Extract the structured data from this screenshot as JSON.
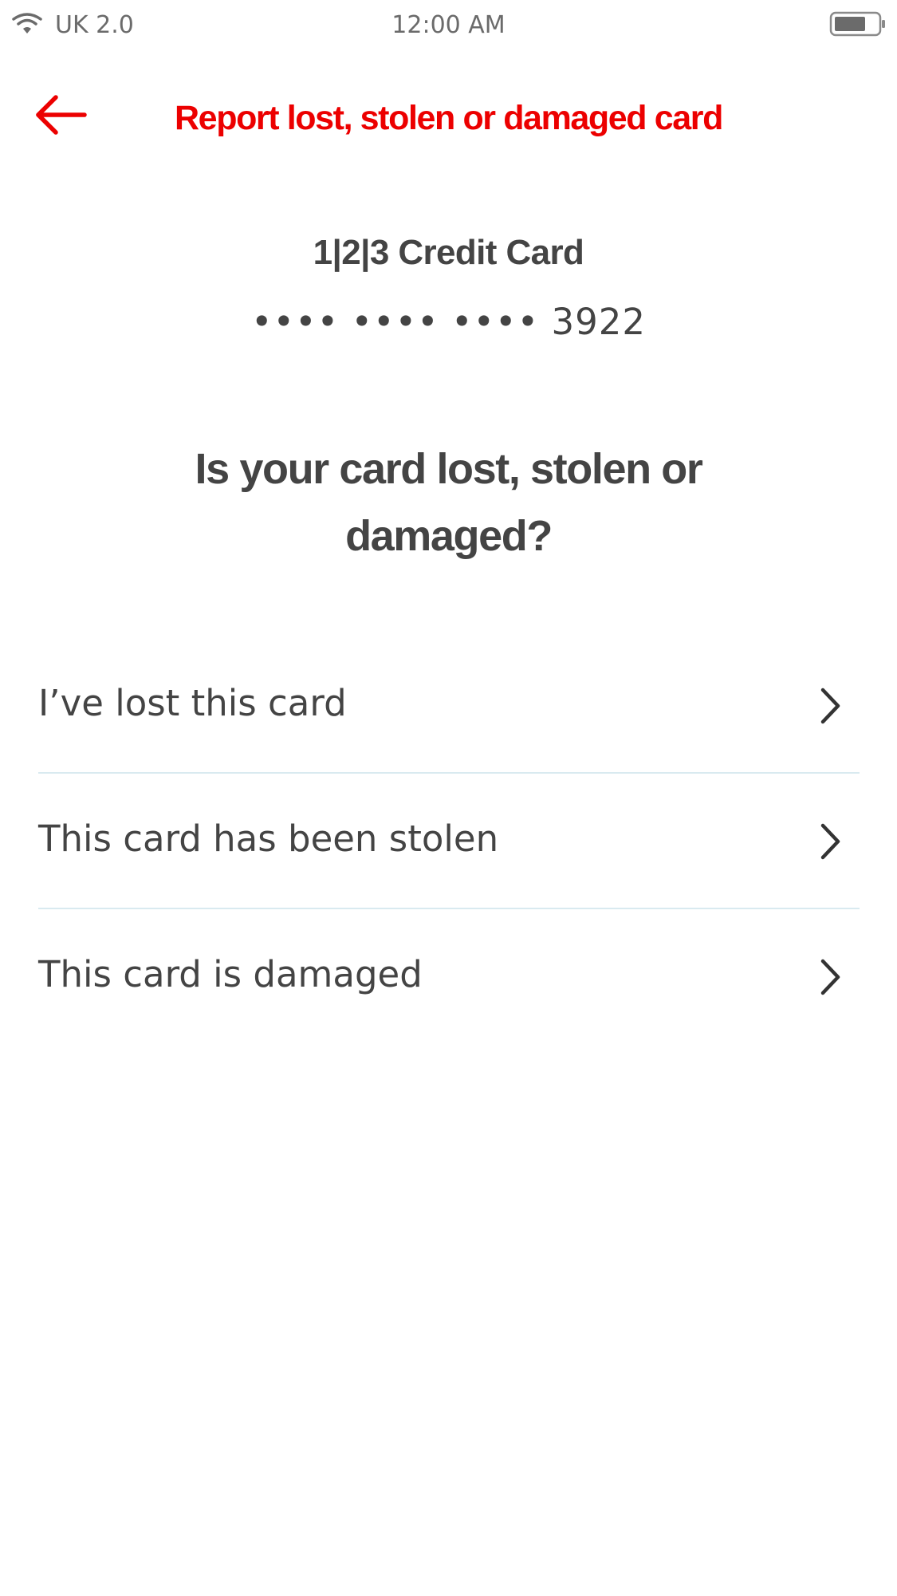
{
  "status_bar": {
    "carrier": "UK 2.0",
    "time": "12:00 AM",
    "wifi_icon": "wifi-icon",
    "battery_icon": "battery-icon"
  },
  "header": {
    "back_icon": "arrow-left-icon",
    "title": "Report lost, stolen or damaged card"
  },
  "card": {
    "name": "1|2|3 Credit Card",
    "masked_number": "•••• •••• •••• 3922"
  },
  "question": "Is your card lost, stolen or damaged?",
  "options": [
    {
      "label": "I’ve lost this card",
      "icon": "chevron-right-icon"
    },
    {
      "label": "This card has been stolen",
      "icon": "chevron-right-icon"
    },
    {
      "label": "This card is damaged",
      "icon": "chevron-right-icon"
    }
  ],
  "colors": {
    "brand_red": "#ec0000",
    "text": "#444444",
    "divider": "#d9eaf0"
  }
}
